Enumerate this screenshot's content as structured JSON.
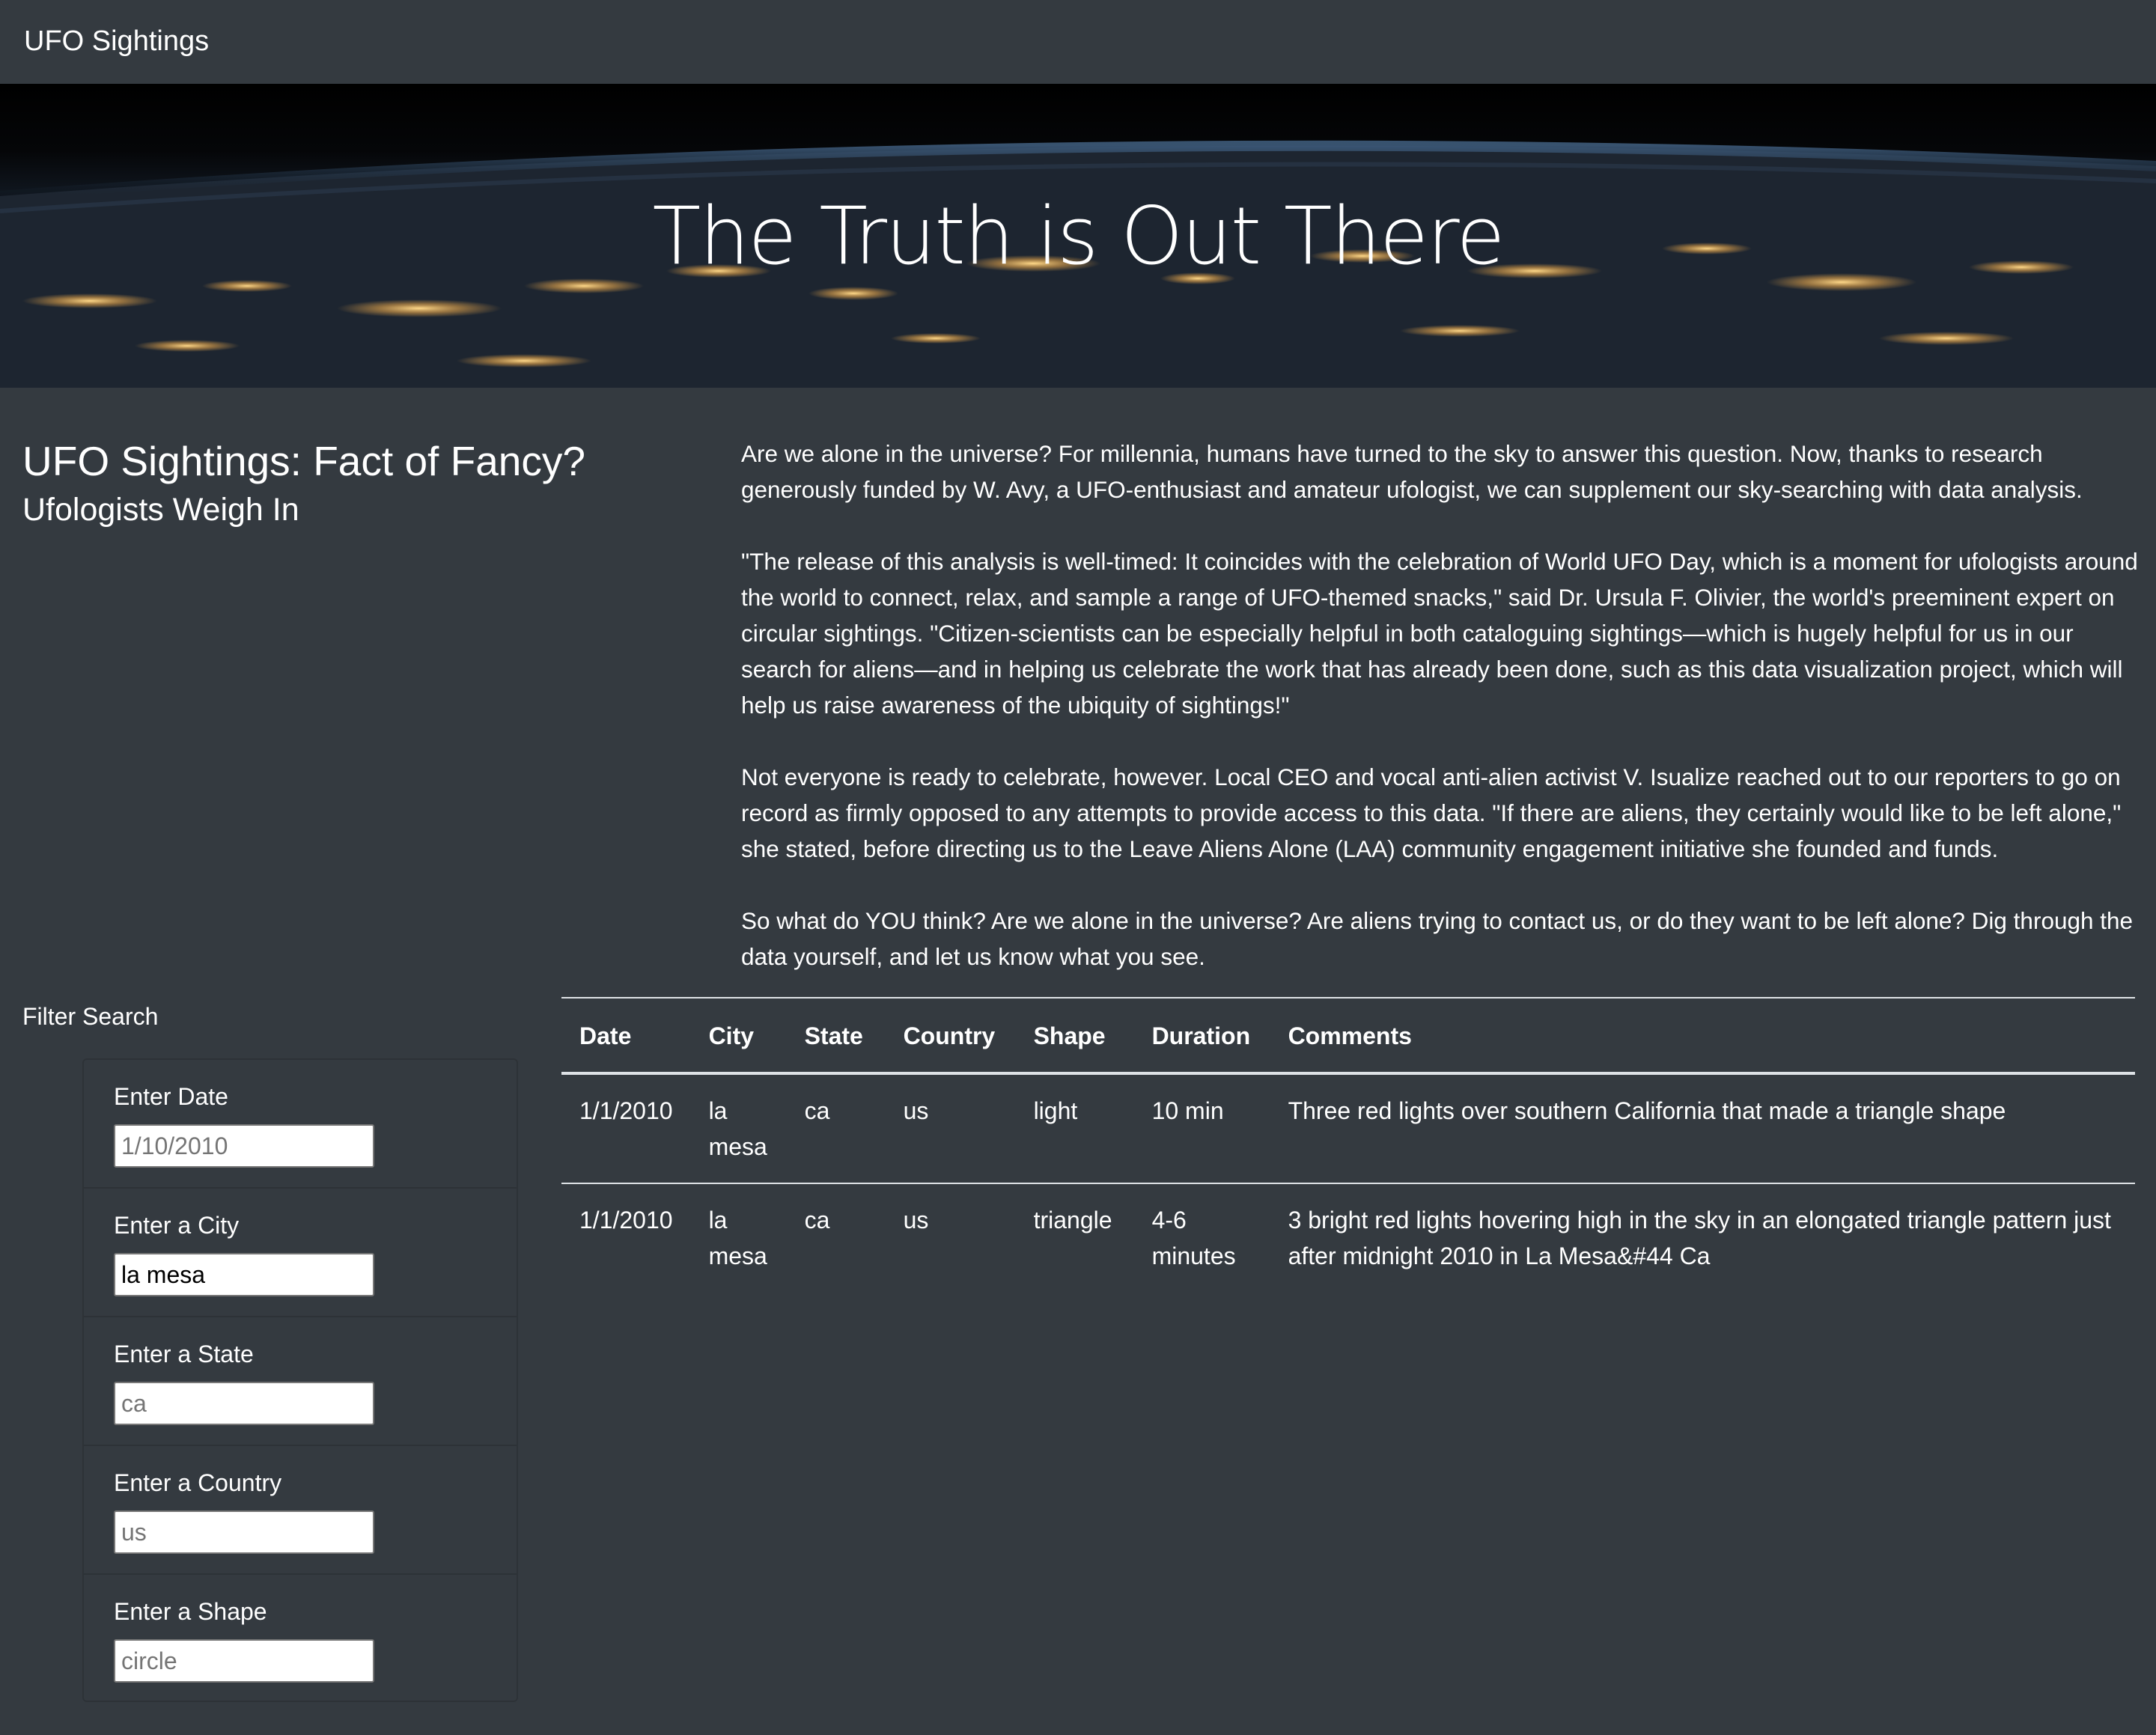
{
  "navbar": {
    "brand": "UFO Sightings"
  },
  "hero": {
    "title": "The Truth is Out There"
  },
  "intro": {
    "heading": "UFO Sightings: Fact of Fancy?",
    "subheading": "Ufologists Weigh In"
  },
  "article": {
    "paragraphs": [
      "Are we alone in the universe? For millennia, humans have turned to the sky to answer this question. Now, thanks to research generously funded by W. Avy, a UFO-enthusiast and amateur ufologist, we can supplement our sky-searching with data analysis.",
      "\"The release of this analysis is well-timed: It coincides with the celebration of World UFO Day, which is a moment for ufologists around the world to connect, relax, and sample a range of UFO-themed snacks,\" said Dr. Ursula F. Olivier, the world's preeminent expert on circular sightings. \"Citizen-scientists can be especially helpful in both cataloguing sightings—which is hugely helpful for us in our search for aliens—and in helping us celebrate the work that has already been done, such as this data visualization project, which will help us raise awareness of the ubiquity of sightings!\"",
      "Not everyone is ready to celebrate, however. Local CEO and vocal anti-alien activist V. Isualize reached out to our reporters to go on record as firmly opposed to any attempts to provide access to this data. \"If there are aliens, they certainly would like to be left alone,\" she stated, before directing us to the Leave Aliens Alone (LAA) community engagement initiative she founded and funds.",
      "So what do YOU think? Are we alone in the universe? Are aliens trying to contact us, or do they want to be left alone? Dig through the data yourself, and let us know what you see."
    ]
  },
  "filters": {
    "title": "Filter Search",
    "items": [
      {
        "label": "Enter Date",
        "value": "",
        "placeholder": "1/10/2010"
      },
      {
        "label": "Enter a City",
        "value": "la mesa",
        "placeholder": ""
      },
      {
        "label": "Enter a State",
        "value": "",
        "placeholder": "ca"
      },
      {
        "label": "Enter a Country",
        "value": "",
        "placeholder": "us"
      },
      {
        "label": "Enter a Shape",
        "value": "",
        "placeholder": "circle"
      }
    ]
  },
  "table": {
    "headers": [
      "Date",
      "City",
      "State",
      "Country",
      "Shape",
      "Duration",
      "Comments"
    ],
    "rows": [
      [
        "1/1/2010",
        "la mesa",
        "ca",
        "us",
        "light",
        "10 min",
        "Three red lights over southern California that made a triangle shape"
      ],
      [
        "1/1/2010",
        "la mesa",
        "ca",
        "us",
        "triangle",
        "4-6 minutes",
        "3 bright red lights hovering high in the sky in an elongated triangle pattern just after midnight 2010 in La Mesa&#44 Ca"
      ]
    ]
  }
}
